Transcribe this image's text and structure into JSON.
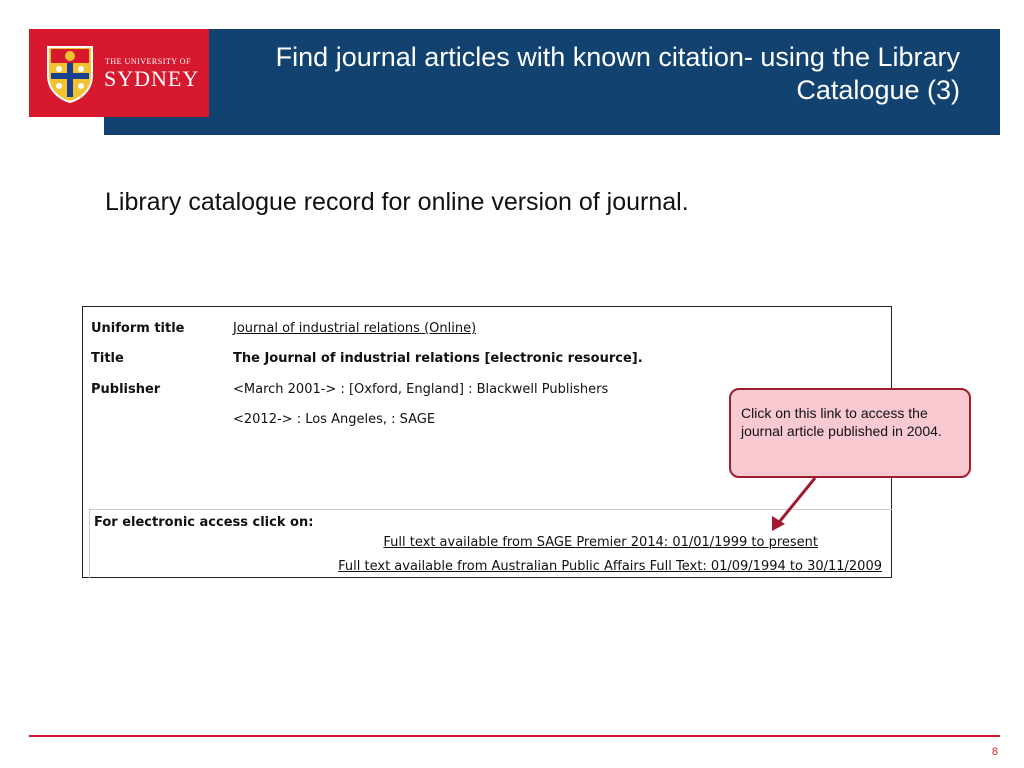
{
  "header": {
    "title": "Find journal articles with known citation- using the Library Catalogue (3)",
    "bar_color": "#124370"
  },
  "logo": {
    "line1": "THE UNIVERSITY OF",
    "line2": "SYDNEY",
    "background": "#d6192f",
    "icon": "university-crest"
  },
  "subtitle": "Library catalogue record for online version of journal.",
  "record": {
    "fields": [
      {
        "label": "Uniform title",
        "value": "Journal of industrial relations (Online)"
      },
      {
        "label": "Title",
        "value": "The Journal of industrial relations [electronic resource]."
      },
      {
        "label": "Publisher",
        "value": "<March 2001-> : [Oxford, England] : Blackwell Publishers"
      },
      {
        "label": "",
        "value": "<2012-> : Los Angeles, : SAGE"
      }
    ],
    "access": {
      "heading": "For electronic access click on:",
      "links": [
        "Full text available from SAGE Premier 2014: 01/01/1999 to present",
        "Full text available from Australian Public Affairs Full Text: 01/09/1994 to 30/11/2009"
      ]
    }
  },
  "callout": {
    "text": "Click on this link to access the journal article published in 2004.",
    "fill": "#f8c9d0",
    "border": "#9e1c2d"
  },
  "footer": {
    "page_number": "8",
    "accent": "#d6192f"
  }
}
